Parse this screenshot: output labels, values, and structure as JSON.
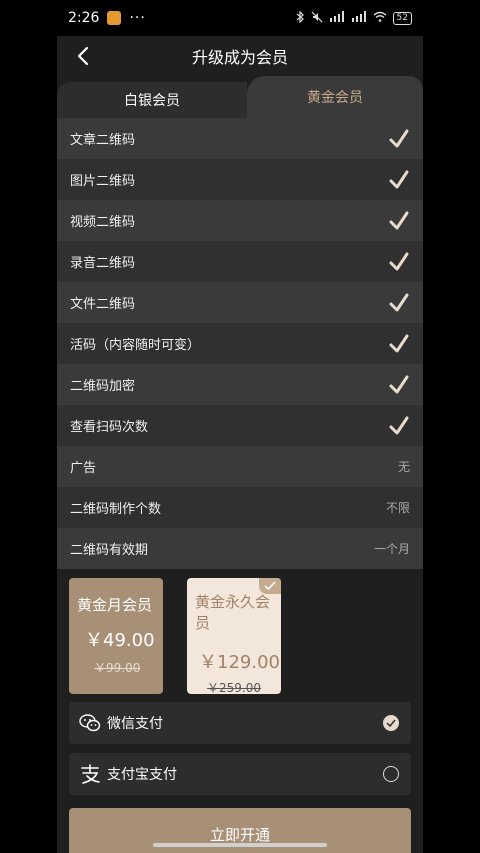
{
  "status": {
    "time": "2:26",
    "more": "···",
    "signal1": "5G",
    "signal2": "5G",
    "battery": "52"
  },
  "header": {
    "title": "升级成为会员"
  },
  "tabs": [
    {
      "label": "白银会员",
      "active": false
    },
    {
      "label": "黄金会员",
      "active": true
    }
  ],
  "features": [
    {
      "label": "文章二维码",
      "icon": "check-icon"
    },
    {
      "label": "图片二维码",
      "icon": "check-icon"
    },
    {
      "label": "视频二维码",
      "icon": "check-icon"
    },
    {
      "label": "录音二维码",
      "icon": "check-icon"
    },
    {
      "label": "文件二维码",
      "icon": "check-icon"
    },
    {
      "label": "活码（内容随时可变）",
      "icon": "check-icon"
    },
    {
      "label": "二维码加密",
      "icon": "check-icon"
    },
    {
      "label": "查看扫码次数",
      "icon": "check-icon"
    },
    {
      "label": "广告",
      "value": "无"
    },
    {
      "label": "二维码制作个数",
      "value": "不限"
    },
    {
      "label": "二维码有效期",
      "value": "一个月"
    }
  ],
  "plans": [
    {
      "name": "黄金月会员",
      "price": "￥49.00",
      "old_price": "￥99.00",
      "selected": false
    },
    {
      "name": "黄金永久会员",
      "price": "￥129.00",
      "old_price": "￥259.00",
      "selected": true
    }
  ],
  "payment": [
    {
      "label": "微信支付",
      "icon": "wechat-icon",
      "selected": true
    },
    {
      "label": "支付宝支付",
      "icon": "alipay-icon",
      "selected": false
    }
  ],
  "action": {
    "label": "立即开通"
  },
  "colors": {
    "accent": "#a89077",
    "gold_text": "#c7ab8a",
    "background": "#1f1f1f"
  }
}
